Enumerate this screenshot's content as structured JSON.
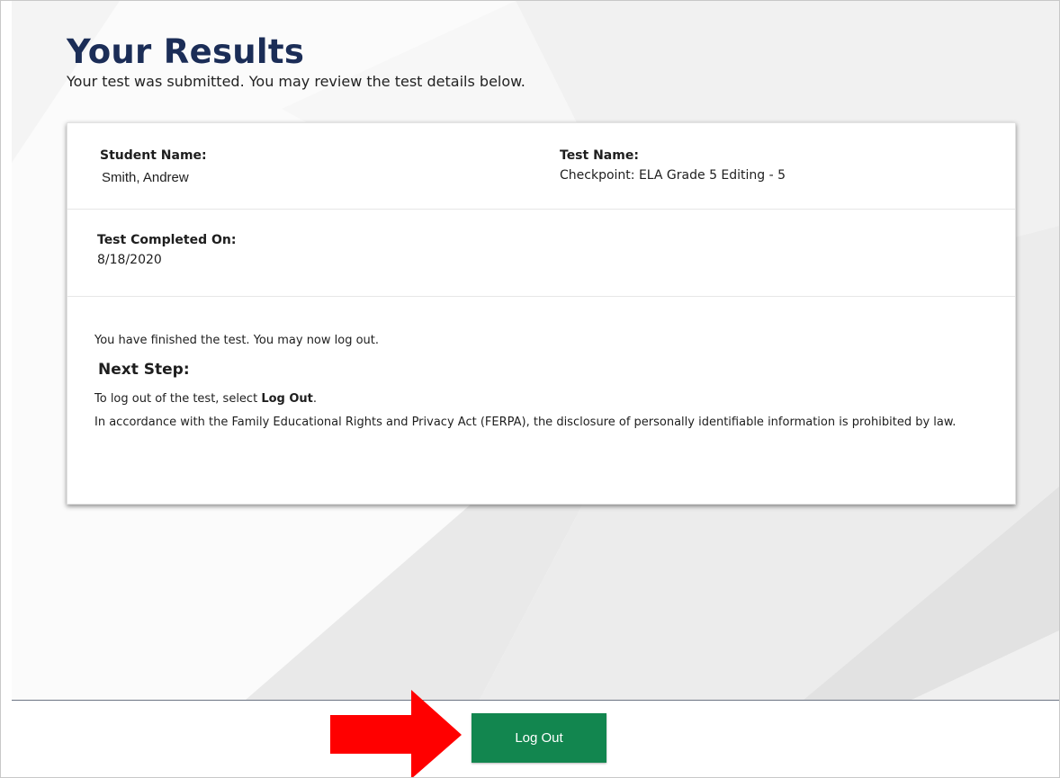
{
  "header": {
    "title": "Your Results",
    "subtitle": "Your test was submitted. You may review the test details below."
  },
  "card": {
    "student_name_label": "Student Name:",
    "student_name_value": "Smith, Andrew",
    "test_name_label": "Test Name:",
    "test_name_value": "Checkpoint: ELA Grade 5 Editing - 5",
    "completed_label": "Test Completed On:",
    "completed_value": "8/18/2020",
    "finished_message": "You have finished the test. You may now log out.",
    "next_step_heading": "Next Step:",
    "instruction_prefix": "To log out of the test, select ",
    "instruction_bold": "Log Out",
    "instruction_suffix": ".",
    "ferpa_notice": "In accordance with the Family Educational Rights and Privacy Act (FERPA), the disclosure of personally identifiable information is prohibited by law."
  },
  "footer": {
    "logout_label": "Log Out"
  },
  "annotation": {
    "icon": "right-arrow-icon",
    "color": "#ff0000"
  },
  "colors": {
    "title": "#1b2d57",
    "button": "#12864f",
    "divider": "#6d7584"
  }
}
